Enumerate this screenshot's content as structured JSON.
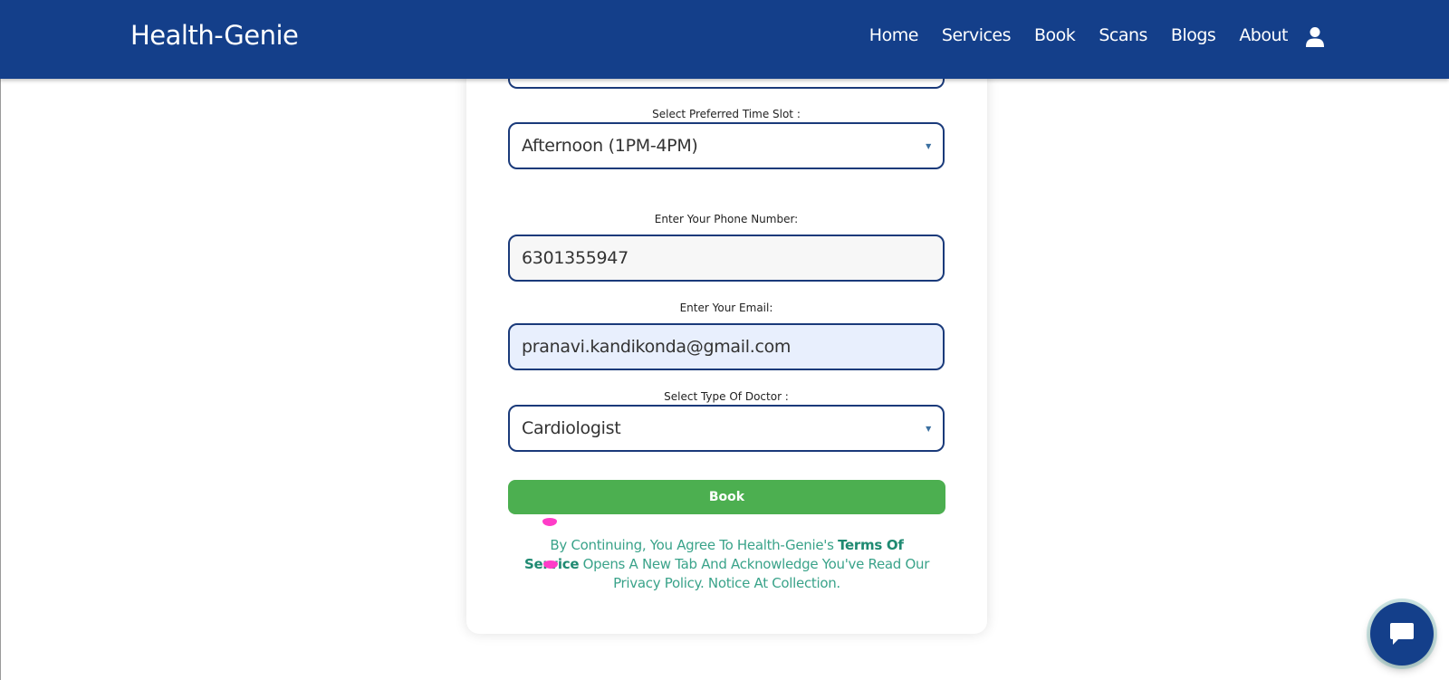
{
  "brand": "Health-Genie",
  "nav": {
    "links": [
      "Home",
      "Services",
      "Book",
      "Scans",
      "Blogs",
      "About"
    ],
    "user_icon": "user-icon"
  },
  "form": {
    "time_slot_label": "Select Preferred Time Slot :",
    "time_slot_value": "Afternoon (1PM-4PM)",
    "phone_label": "Enter Your Phone Number:",
    "phone_value": "6301355947",
    "email_label": "Enter Your Email:",
    "email_value": "pranavi.kandikonda@gmail.com",
    "doctor_label": "Select Type Of Doctor :",
    "doctor_value": "Cardiologist",
    "book_label": "Book"
  },
  "legal": {
    "prefix": "By Continuing, You Agree To Health-Genie's",
    "tos_link": "Terms Of Service",
    "suffix": "Opens A New Tab And Acknowledge You've Read Our Privacy Policy. Notice At Collection."
  },
  "chat_icon": "chat-bubble-icon",
  "colors": {
    "nav_bg": "#143f8a",
    "accent_green": "#4caf50",
    "legal_text": "#3aa38a",
    "field_border": "#1a3a7a"
  }
}
